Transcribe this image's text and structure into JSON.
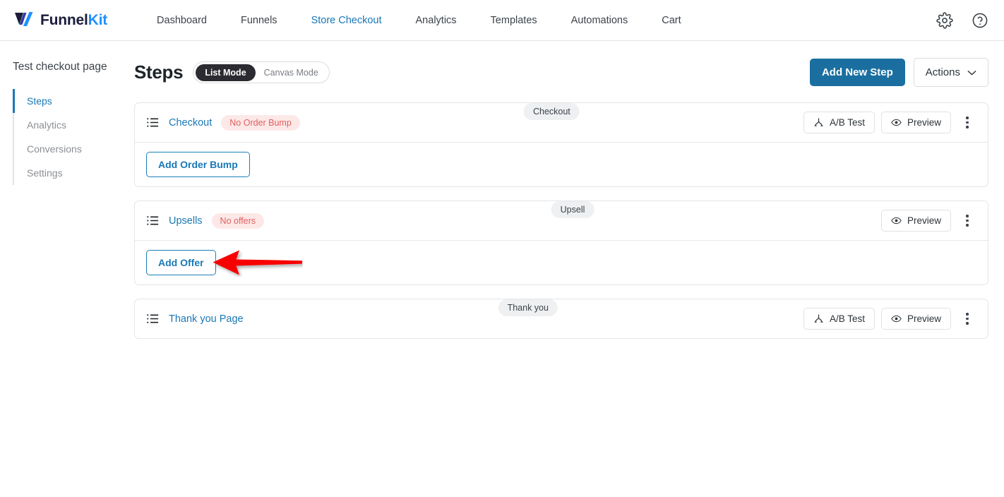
{
  "topbar": {
    "logo": {
      "name": "FunnelKit",
      "part1": "Funnel",
      "part2": "Kit",
      "icon": "funnelkit-logo-icon"
    },
    "nav": [
      {
        "label": "Dashboard",
        "active": false
      },
      {
        "label": "Funnels",
        "active": false
      },
      {
        "label": "Store Checkout",
        "active": true
      },
      {
        "label": "Analytics",
        "active": false
      },
      {
        "label": "Templates",
        "active": false
      },
      {
        "label": "Automations",
        "active": false
      },
      {
        "label": "Cart",
        "active": false
      }
    ],
    "settings_icon": "gear-icon",
    "help_icon": "help-circle-icon"
  },
  "sidebar": {
    "title": "Test checkout page",
    "items": [
      {
        "label": "Steps",
        "active": true
      },
      {
        "label": "Analytics",
        "active": false
      },
      {
        "label": "Conversions",
        "active": false
      },
      {
        "label": "Settings",
        "active": false
      }
    ]
  },
  "main": {
    "title": "Steps",
    "mode_toggle": {
      "list_label": "List Mode",
      "canvas_label": "Canvas Mode",
      "selected": "List Mode"
    },
    "add_new_step_label": "Add New Step",
    "actions_label": "Actions",
    "steps": [
      {
        "name": "Checkout",
        "status_badge": "No Order Bump",
        "type_badge": "Checkout",
        "has_ab_test": true,
        "ab_test_label": "A/B Test",
        "preview_label": "Preview",
        "body_button": "Add Order Bump",
        "has_body": true,
        "has_arrow": false
      },
      {
        "name": "Upsells",
        "status_badge": "No offers",
        "type_badge": "Upsell",
        "has_ab_test": false,
        "ab_test_label": "A/B Test",
        "preview_label": "Preview",
        "body_button": "Add Offer",
        "has_body": true,
        "has_arrow": true
      },
      {
        "name": "Thank you Page",
        "status_badge": "",
        "type_badge": "Thank you",
        "has_ab_test": true,
        "ab_test_label": "A/B Test",
        "preview_label": "Preview",
        "body_button": "",
        "has_body": false,
        "has_arrow": false
      }
    ]
  },
  "colors": {
    "accent_blue": "#1978b6",
    "primary_button": "#1a6fa0",
    "badge_warn_bg": "#fde8e8",
    "badge_warn_text": "#e0605f",
    "type_badge_bg": "#eef0f2",
    "annotation_arrow": "#f90000",
    "logo_dark": "#1b1c3a",
    "logo_blue": "#1e90ff"
  }
}
